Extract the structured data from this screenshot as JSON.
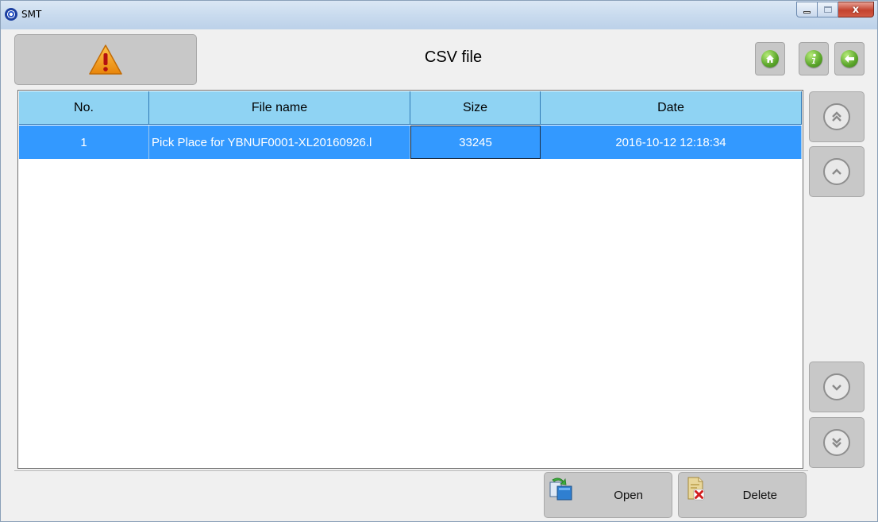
{
  "window": {
    "title": "SMT",
    "controls": {
      "minimize_icon": "minimize-icon",
      "maximize_icon": "maximize-icon",
      "close_label": "x"
    }
  },
  "header": {
    "title": "CSV file",
    "warning_icon": "warning-icon",
    "buttons": [
      {
        "name": "home-button",
        "icon": "home-icon"
      },
      {
        "name": "info-button",
        "icon": "info-icon"
      },
      {
        "name": "back-button",
        "icon": "back-arrow-icon"
      }
    ]
  },
  "table": {
    "columns": [
      "No.",
      "File name",
      "Size",
      "Date"
    ],
    "rows": [
      {
        "no": "1",
        "file_name": "Pick Place for YBNUF0001-XL20160926.l",
        "size": "33245",
        "date": "2016-10-12 12:18:34",
        "selected": true
      }
    ]
  },
  "scroll": {
    "top_icon": "double-chevron-up-icon",
    "up_icon": "chevron-up-icon",
    "down_icon": "chevron-down-icon",
    "bottom_icon": "double-chevron-down-icon"
  },
  "actions": {
    "open_label": "Open",
    "delete_label": "Delete"
  },
  "colors": {
    "header_bg": "#8fd3f3",
    "selected_row": "#3399ff",
    "button_bg": "#c8c8c8",
    "accent_green": "#5aa52a",
    "warning_orange": "#f29a1c"
  }
}
